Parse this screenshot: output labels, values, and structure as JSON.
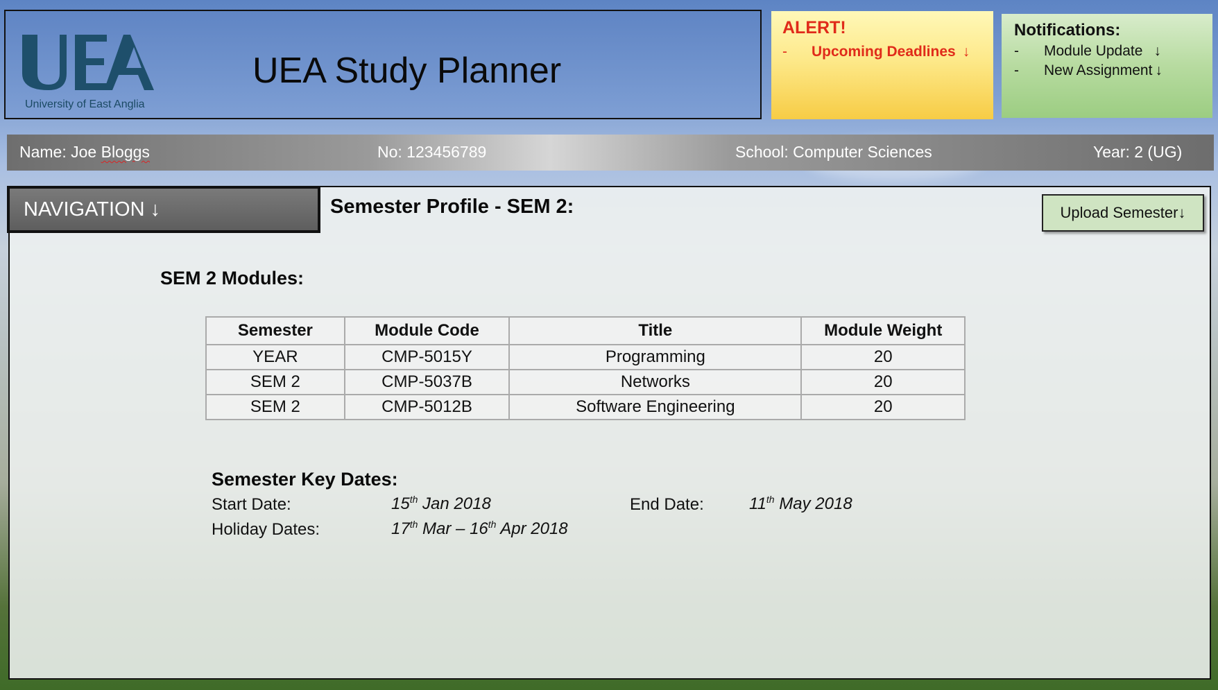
{
  "header": {
    "logo_letters": "UEA",
    "logo_caption": "University of East Anglia",
    "app_title": "UEA Study Planner"
  },
  "alert": {
    "title": "ALERT!",
    "item_dash": "-",
    "item": "Upcoming Deadlines",
    "arrow": "↓",
    "color": "#e02b1a"
  },
  "notifications": {
    "title": "Notifications:",
    "items": [
      {
        "dash": "-",
        "label": "Module Update",
        "arrow": "↓"
      },
      {
        "dash": "-",
        "label": "New Assignment",
        "arrow": "↓"
      }
    ]
  },
  "student": {
    "name_prefix": "Name: Joe ",
    "name_last": "Bloggs",
    "number": "No: 123456789",
    "school": "School: Computer Sciences",
    "year": "Year: 2 (UG)"
  },
  "nav": {
    "label": "NAVIGATION ↓"
  },
  "page": {
    "heading": "Semester Profile - SEM 2:",
    "upload_label": "Upload Semester↓"
  },
  "modules": {
    "title": "SEM 2 Modules:",
    "columns": [
      "Semester",
      "Module Code",
      "Title",
      "Module Weight"
    ],
    "rows": [
      [
        "YEAR",
        "CMP-5015Y",
        "Programming",
        "20"
      ],
      [
        "SEM 2",
        "CMP-5037B",
        "Networks",
        "20"
      ],
      [
        "SEM 2",
        "CMP-5012B",
        "Software Engineering",
        "20"
      ]
    ]
  },
  "key_dates": {
    "title": "Semester Key Dates:",
    "start_label": "Start Date:",
    "start_day": "15",
    "start_sup": "th",
    "start_rest": " Jan 2018",
    "end_label": "End Date:",
    "end_day": "11",
    "end_sup": "th",
    "end_rest": " May 2018",
    "holiday_label": "Holiday Dates:",
    "holiday_day1": "17",
    "holiday_sup1": "th",
    "holiday_mid": " Mar – ",
    "holiday_day2": "16",
    "holiday_sup2": "th",
    "holiday_rest": " Apr 2018"
  }
}
